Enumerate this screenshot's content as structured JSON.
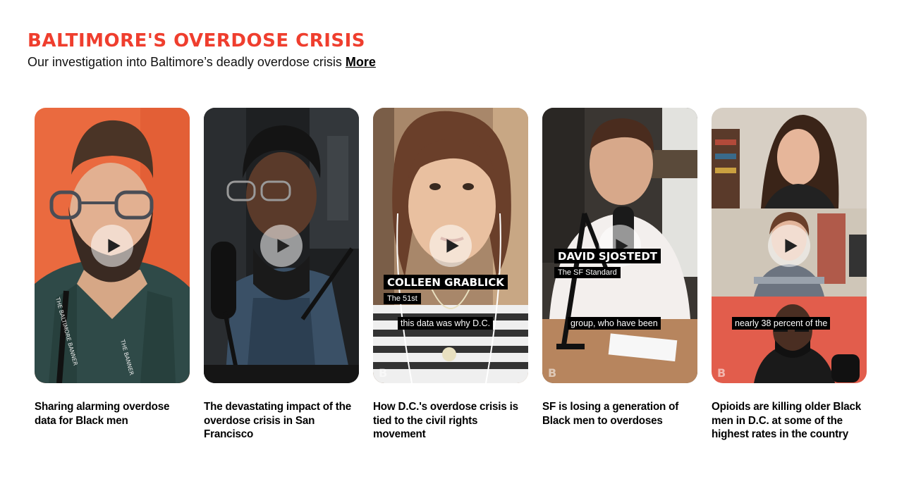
{
  "section": {
    "title": "BALTIMORE'S OVERDOSE CRISIS",
    "description": "Our investigation into Baltimore’s deadly overdose crisis ",
    "more_label": "More"
  },
  "colors": {
    "accent": "#ef3e2e"
  },
  "videos": [
    {
      "title": "Sharing alarming overdose data for Black men",
      "icon": "play-icon"
    },
    {
      "title": "The devastating impact of the overdose crisis in San Francisco",
      "icon": "play-icon"
    },
    {
      "title": "How D.C.'s overdose crisis is tied to the civil rights movement",
      "icon": "play-icon",
      "name_tag": "COLLEEN GRABLICK",
      "org_tag": "The 51st",
      "caption": "this data was why D.C."
    },
    {
      "title": "SF is losing a generation of Black men to overdoses",
      "icon": "play-icon",
      "name_tag": "DAVID SJOSTEDT",
      "org_tag": "The SF Standard",
      "caption": "group, who have been"
    },
    {
      "title": "Opioids are killing older Black men in D.C. at some of the highest rates in the country",
      "icon": "play-icon",
      "caption": "nearly 38 percent of the"
    }
  ]
}
